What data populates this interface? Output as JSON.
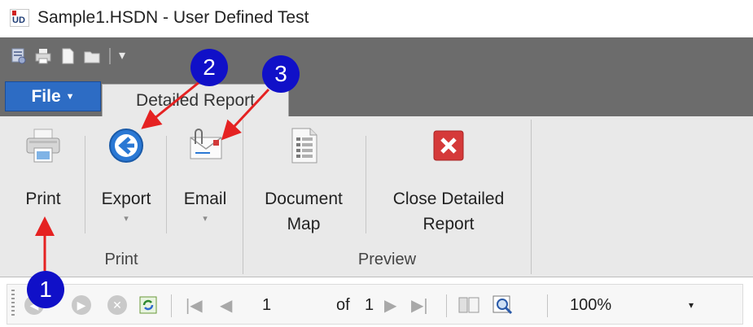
{
  "window": {
    "app_icon_text": "UD",
    "title": "Sample1.HSDN - User Defined Test"
  },
  "quick_access": {
    "icons": [
      "report-icon",
      "print-icon",
      "document-icon",
      "open-folder-icon"
    ],
    "more_glyph": "▾"
  },
  "tabs": {
    "file_label": "File",
    "file_caret": "▼",
    "active_tab": "Detailed Report"
  },
  "ribbon": {
    "groups": [
      {
        "label": "Print",
        "buttons": [
          {
            "label": "Print",
            "icon": "printer-icon"
          }
        ]
      },
      {
        "label": "",
        "buttons": [
          {
            "label": "Export",
            "icon": "export-arrow-icon",
            "dropdown": "▾"
          },
          {
            "label": "Email",
            "icon": "email-icon",
            "dropdown": "▾"
          }
        ]
      },
      {
        "label": "Preview",
        "buttons": [
          {
            "label_line1": "Document",
            "label_line2": "Map",
            "icon": "document-map-icon"
          },
          {
            "label_line1": "Close Detailed",
            "label_line2": "Report",
            "icon": "close-red-icon"
          }
        ]
      }
    ]
  },
  "toolbar": {
    "current_page": "1",
    "of_label": "of",
    "total_pages": "1",
    "zoom": "100%",
    "zoom_caret": "▾"
  },
  "annotations": {
    "one": "1",
    "two": "2",
    "three": "3",
    "arrow_color": "#e52222",
    "badge_color": "#1010c8"
  }
}
